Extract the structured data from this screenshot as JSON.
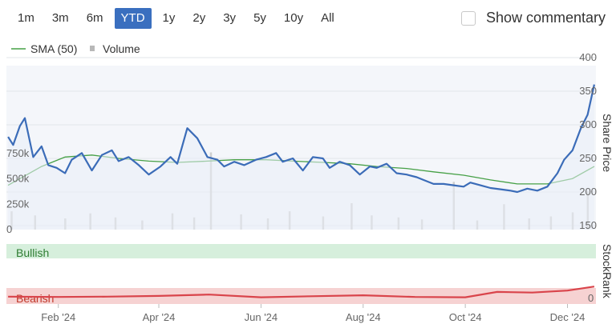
{
  "toolbar": {
    "ranges": [
      "1m",
      "3m",
      "6m",
      "YTD",
      "1y",
      "2y",
      "3y",
      "5y",
      "10y",
      "All"
    ],
    "active_range": "YTD",
    "commentary_label": "Show commentary",
    "commentary_checked": false
  },
  "legend": {
    "sma_label": "SMA (50)",
    "volume_label": "Volume"
  },
  "colors": {
    "price_line": "#3b6cb8",
    "sma_line": "#46a046",
    "volume_bar": "#cfcfcf",
    "bullish_band": "#d6efdc",
    "bearish_band": "#f6d2d2",
    "stockrank_line": "#d9444b",
    "active_button": "#3a6fbf"
  },
  "chart_data": {
    "type": "line",
    "x_axis": {
      "tick_labels": [
        "Feb '24",
        "Apr '24",
        "Jun '24",
        "Aug '24",
        "Oct '24",
        "Dec '24"
      ]
    },
    "price_axis": {
      "title": "Share Price",
      "tick_labels": [
        "150",
        "200",
        "250",
        "300",
        "350",
        "400"
      ],
      "range": [
        150,
        400
      ]
    },
    "volume_axis": {
      "tick_labels": [
        "0",
        "250k",
        "500k",
        "750k"
      ],
      "range": [
        0,
        1000000
      ]
    },
    "stockrank_axis": {
      "title": "StockRank",
      "tick_labels": [
        "0"
      ],
      "range": [
        0,
        100
      ]
    },
    "bands": [
      "Bullish",
      "Bearish"
    ],
    "series": [
      {
        "name": "Share Price",
        "x": [
          "2024-01-02",
          "2024-01-05",
          "2024-01-09",
          "2024-01-12",
          "2024-01-17",
          "2024-01-22",
          "2024-01-26",
          "2024-01-31",
          "2024-02-05",
          "2024-02-09",
          "2024-02-15",
          "2024-02-21",
          "2024-02-27",
          "2024-03-04",
          "2024-03-08",
          "2024-03-14",
          "2024-03-20",
          "2024-03-26",
          "2024-04-02",
          "2024-04-08",
          "2024-04-12",
          "2024-04-18",
          "2024-04-24",
          "2024-04-30",
          "2024-05-06",
          "2024-05-10",
          "2024-05-16",
          "2024-05-22",
          "2024-05-29",
          "2024-06-04",
          "2024-06-10",
          "2024-06-14",
          "2024-06-20",
          "2024-06-26",
          "2024-07-02",
          "2024-07-08",
          "2024-07-12",
          "2024-07-18",
          "2024-07-24",
          "2024-07-30",
          "2024-08-05",
          "2024-08-09",
          "2024-08-15",
          "2024-08-21",
          "2024-08-27",
          "2024-09-02",
          "2024-09-06",
          "2024-09-12",
          "2024-09-18",
          "2024-09-24",
          "2024-09-30",
          "2024-10-04",
          "2024-10-10",
          "2024-10-16",
          "2024-10-22",
          "2024-10-28",
          "2024-11-01",
          "2024-11-07",
          "2024-11-13",
          "2024-11-19",
          "2024-11-25",
          "2024-11-29",
          "2024-12-04",
          "2024-12-09",
          "2024-12-13",
          "2024-12-17"
        ],
        "values": [
          282,
          270,
          298,
          310,
          252,
          268,
          240,
          236,
          228,
          248,
          258,
          232,
          255,
          262,
          246,
          252,
          240,
          226,
          238,
          252,
          242,
          295,
          280,
          252,
          248,
          238,
          245,
          240,
          248,
          252,
          258,
          245,
          250,
          232,
          252,
          250,
          236,
          245,
          240,
          226,
          238,
          236,
          242,
          228,
          226,
          222,
          218,
          212,
          212,
          210,
          208,
          214,
          210,
          206,
          204,
          202,
          200,
          205,
          202,
          208,
          228,
          248,
          262,
          295,
          315,
          360
        ]
      },
      {
        "name": "SMA (50)",
        "x": [
          "2024-01-02",
          "2024-01-22",
          "2024-02-05",
          "2024-02-21",
          "2024-03-08",
          "2024-03-26",
          "2024-04-12",
          "2024-04-30",
          "2024-05-16",
          "2024-06-04",
          "2024-06-20",
          "2024-07-08",
          "2024-07-24",
          "2024-08-09",
          "2024-08-27",
          "2024-09-12",
          "2024-09-30",
          "2024-10-16",
          "2024-11-01",
          "2024-11-19",
          "2024-12-04",
          "2024-12-17"
        ],
        "values": [
          210,
          238,
          252,
          255,
          250,
          246,
          244,
          246,
          248,
          248,
          246,
          244,
          242,
          238,
          235,
          230,
          225,
          218,
          212,
          212,
          220,
          238
        ]
      },
      {
        "name": "Volume",
        "x": [
          "2024-01-04",
          "2024-01-18",
          "2024-02-05",
          "2024-02-20",
          "2024-03-06",
          "2024-03-22",
          "2024-04-09",
          "2024-04-22",
          "2024-05-02",
          "2024-05-20",
          "2024-06-05",
          "2024-06-18",
          "2024-07-08",
          "2024-07-25",
          "2024-08-06",
          "2024-08-22",
          "2024-09-05",
          "2024-09-24",
          "2024-10-08",
          "2024-10-24",
          "2024-11-08",
          "2024-11-21",
          "2024-12-04",
          "2024-12-13"
        ],
        "values": [
          180000,
          140000,
          110000,
          160000,
          120000,
          90000,
          160000,
          120000,
          760000,
          150000,
          110000,
          180000,
          130000,
          260000,
          140000,
          120000,
          100000,
          470000,
          90000,
          250000,
          110000,
          130000,
          170000,
          380000
        ]
      },
      {
        "name": "StockRank",
        "x": [
          "2024-01-02",
          "2024-02-01",
          "2024-03-01",
          "2024-04-01",
          "2024-05-01",
          "2024-06-01",
          "2024-07-01",
          "2024-08-01",
          "2024-09-01",
          "2024-10-01",
          "2024-10-20",
          "2024-11-10",
          "2024-12-01",
          "2024-12-17"
        ],
        "values": [
          22,
          21,
          22,
          24,
          28,
          20,
          23,
          26,
          21,
          20,
          36,
          34,
          40,
          52
        ]
      }
    ],
    "ylabel": "Share Price",
    "grid": true,
    "legend": "top-left"
  }
}
